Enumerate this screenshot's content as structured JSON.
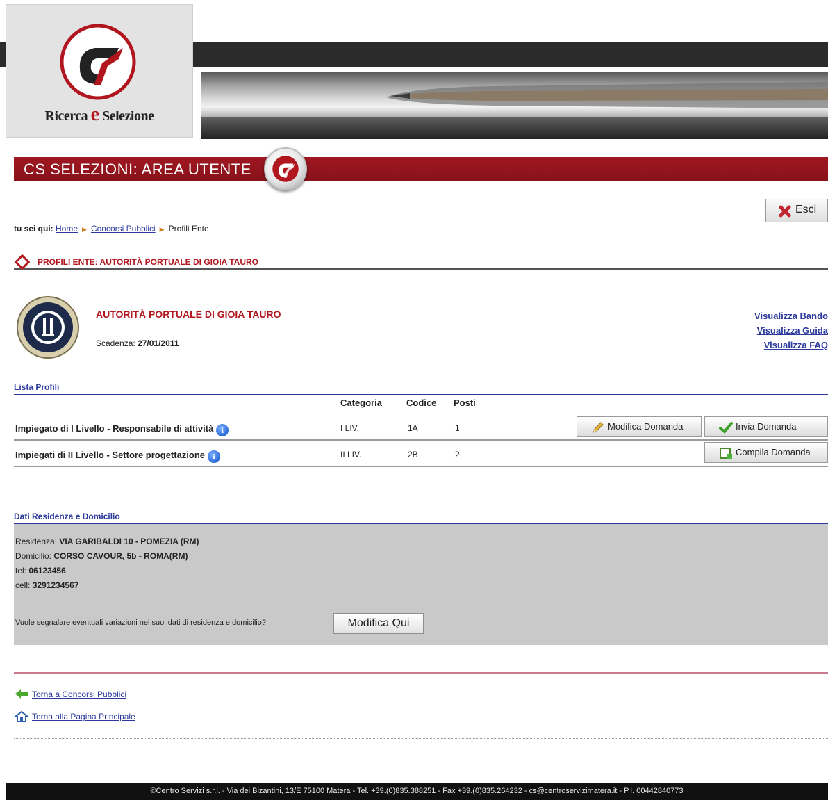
{
  "brand": {
    "logo_text_1": "Ricerca ",
    "logo_text_e": "e",
    "logo_text_2": " Selezione",
    "accent": "#b1161f",
    "dark_bar": "#2b2b2b"
  },
  "area_title": "CS SELEZIONI: AREA UTENTE",
  "logout_label": "Esci",
  "breadcrumb": {
    "prefix": "tu sei qui:",
    "home": "Home",
    "concorsi": "Concorsi Pubblici",
    "current": "Profili Ente"
  },
  "profile_title": "PROFILI ENTE: AUTORITÀ PORTUALE DI GIOIA TAURO",
  "entity": {
    "name": "AUTORITÀ PORTUALE DI GIOIA TAURO",
    "deadline_label": "Scadenza:",
    "deadline_value": "27/01/2011",
    "links": [
      "Visualizza Bando",
      "Visualizza Guida",
      "Visualizza FAQ"
    ]
  },
  "profiles": {
    "heading": "Lista Profili",
    "columns": [
      "Categoria",
      "Codice",
      "Posti"
    ],
    "rows": [
      {
        "name": "Impiegato di I Livello - Responsabile di attività",
        "categoria": "I LIV.",
        "codice": "1A",
        "posti": "1",
        "actions": [
          "Modifica Domanda",
          "Invia Domanda"
        ]
      },
      {
        "name": "Impiegati di II Livello - Settore progettazione",
        "categoria": "II LIV.",
        "codice": "2B",
        "posti": "2",
        "actions": [
          "Compila Domanda"
        ]
      }
    ]
  },
  "residence": {
    "heading": "Dati Residenza e Domicilio",
    "residenza_label": "Residenza:",
    "residenza_value": "VIA GARIBALDI 10 - POMEZIA (RM)",
    "domicilio_label": "Domicilio:",
    "domicilio_value": "CORSO CAVOUR, 5b - ROMA(RM)",
    "tel_label": "tel:",
    "tel_value": "06123456",
    "cell_label": "cell:",
    "cell_value": "3291234567",
    "question": "Vuole segnalare eventuali variazioni nei suoi dati di residenza e domicilio?",
    "button": "Modifica Qui"
  },
  "nav": {
    "back": "Torna a Concorsi Pubblici",
    "home": "Torna alla Pagina Principale"
  },
  "footer": "©Centro Servizi s.r.l. - Via dei Bizantini, 13/E 75100 Matera - Tel. +39.(0)835.388251 - Fax +39.(0)835.264232 - cs@centroservizimatera.it - P.I. 00442840773"
}
